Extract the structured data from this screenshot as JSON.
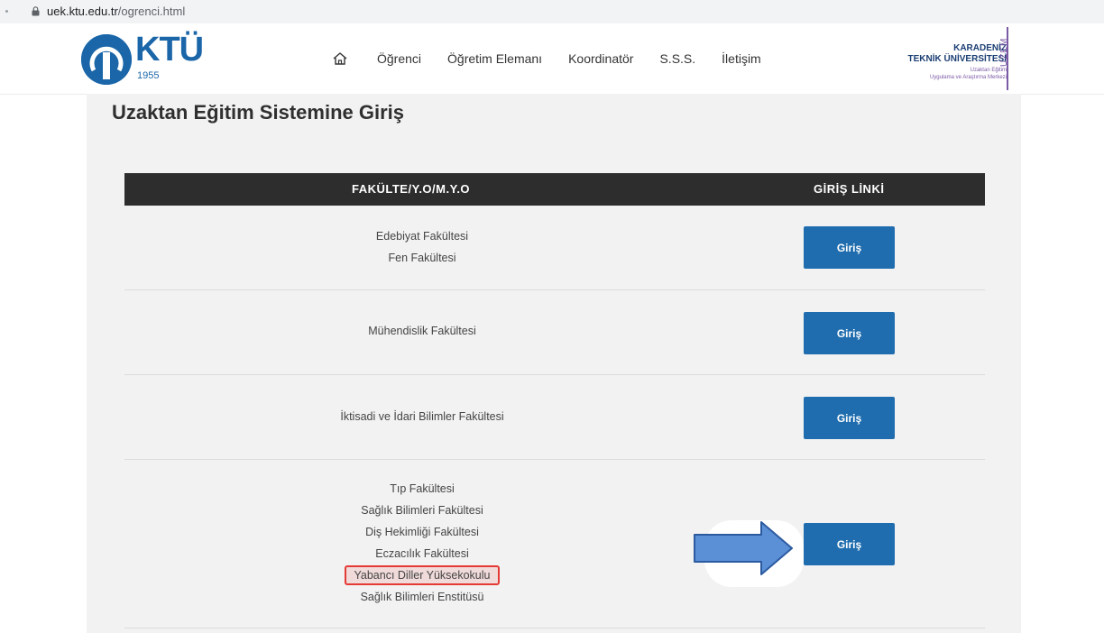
{
  "browser": {
    "url_host": "uek.ktu.edu.tr",
    "url_path": "/ogrenci.html"
  },
  "header": {
    "logo_text": "KTÜ",
    "logo_year": "1955",
    "nav": [
      "Öğrenci",
      "Öğretim Elemanı",
      "Koordinatör",
      "S.S.S.",
      "İletişim"
    ],
    "brand_line1": "KARADENİZ",
    "brand_line2": "TEKNİK ÜNİVERSİTESİ",
    "brand_line3": "Uzaktan Eğitim",
    "brand_line4": "Uygulama ve Araştırma Merkezi",
    "brand_side": "UZEM"
  },
  "page": {
    "title": "Uzaktan Eğitim Sistemine Giriş"
  },
  "table": {
    "col_faculty": "FAKÜLTE/Y.O/M.Y.O",
    "col_link": "GİRİŞ LİNKİ",
    "button_label": "Giriş",
    "rows": [
      {
        "faculties": [
          "Edebiyat Fakültesi",
          "Fen Fakültesi"
        ]
      },
      {
        "faculties": [
          "Mühendislik Fakültesi"
        ]
      },
      {
        "faculties": [
          "İktisadi ve İdari Bilimler Fakültesi"
        ]
      },
      {
        "faculties": [
          "Tıp Fakültesi",
          "Sağlık Bilimleri Fakültesi",
          "Diş Hekimliği Fakültesi",
          "Eczacılık Fakültesi",
          "Yabancı Diller Yüksekokulu",
          "Sağlık Bilimleri Enstitüsü"
        ]
      }
    ]
  },
  "colors": {
    "brand_blue": "#1a66a8",
    "button_blue": "#1f6dae",
    "header_dark": "#2d2d2d",
    "uzem_purple": "#7b5aa6",
    "highlight_red": "#e53935",
    "arrow_blue": "#5b8fd6"
  },
  "icons": {
    "home": "home-icon",
    "lock": "lock-icon"
  }
}
